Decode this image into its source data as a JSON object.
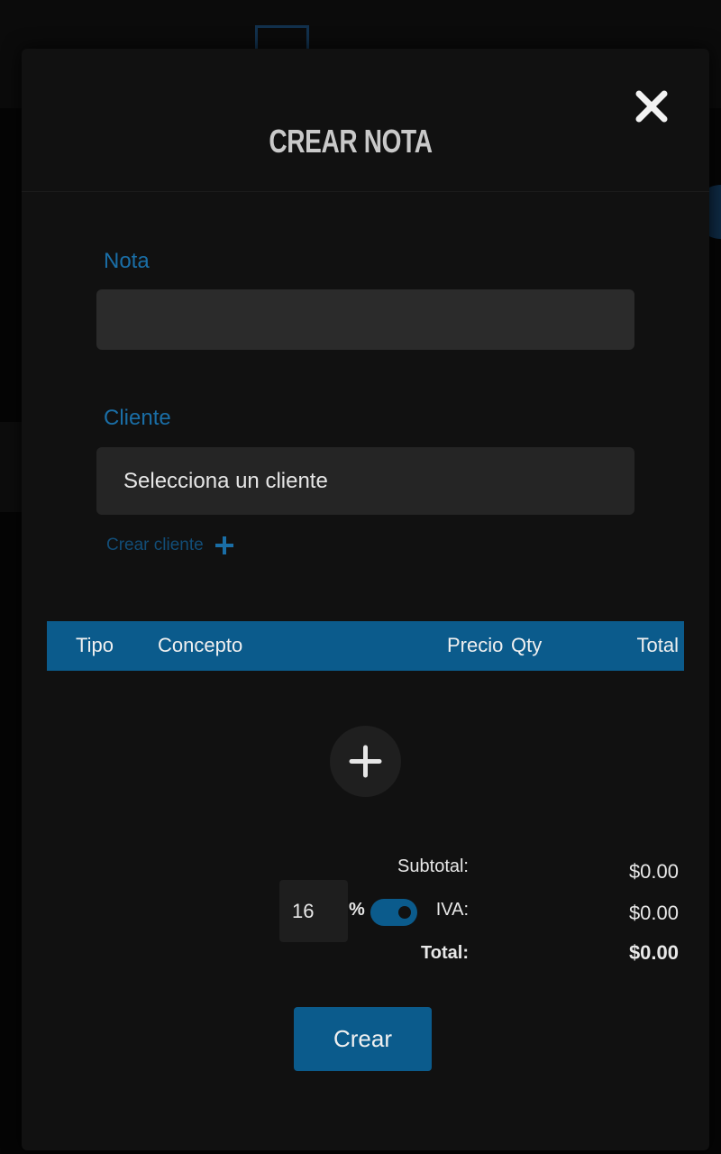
{
  "modal": {
    "title": "CREAR NOTA"
  },
  "form": {
    "nota_label": "Nota",
    "nota_value": "",
    "cliente_label": "Cliente",
    "cliente_selected": "Selecciona un cliente",
    "crear_cliente_label": "Crear cliente"
  },
  "table": {
    "headers": [
      "Tipo",
      "Concepto",
      "Precio",
      "Qty",
      "Total"
    ],
    "rows": []
  },
  "summary": {
    "subtotal_label": "Subtotal:",
    "subtotal_value": "$0.00",
    "iva_percent": "16",
    "iva_percent_sign": "%",
    "iva_enabled": true,
    "iva_label": "IVA:",
    "iva_value": "$0.00",
    "total_label": "Total:",
    "total_value": "$0.00"
  },
  "actions": {
    "submit_label": "Crear"
  },
  "icons": {
    "close": "close-icon",
    "plus_small": "plus-icon",
    "add_row": "plus-icon"
  },
  "colors": {
    "accent": "#0b5b8c",
    "label_blue": "#1a6ea6",
    "modal_bg": "#111111",
    "input_bg": "#2b2b2b"
  }
}
